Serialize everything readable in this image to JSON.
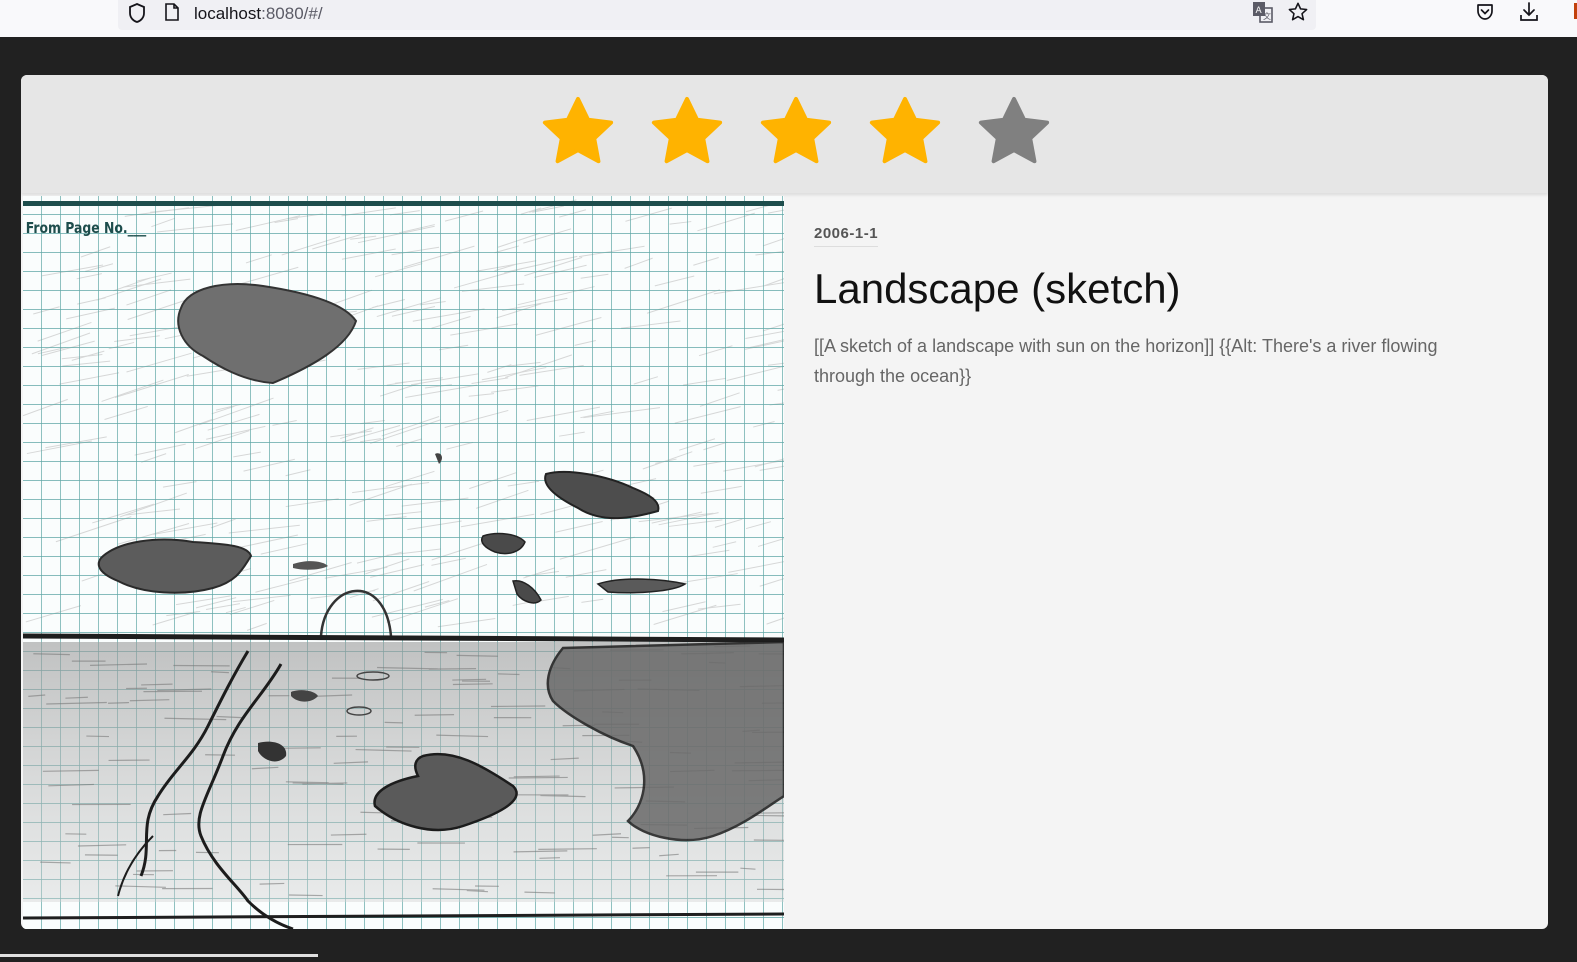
{
  "browser": {
    "url_host": "localhost",
    "url_rest": ":8080/#/",
    "icons": [
      "shield-icon",
      "page-icon",
      "translate-icon",
      "bookmark-star-icon",
      "pocket-icon",
      "download-icon"
    ]
  },
  "rating": {
    "value": 4,
    "max": 5,
    "filled_color": "#ffb300",
    "empty_color": "#808080"
  },
  "item": {
    "date": "2006-1-1",
    "title": "Landscape (sketch)",
    "description": "[[A sketch of a landscape with sun on the horizon]] {{Alt: There's a river flowing through the ocean}}",
    "image_label": "From Page No.___"
  }
}
